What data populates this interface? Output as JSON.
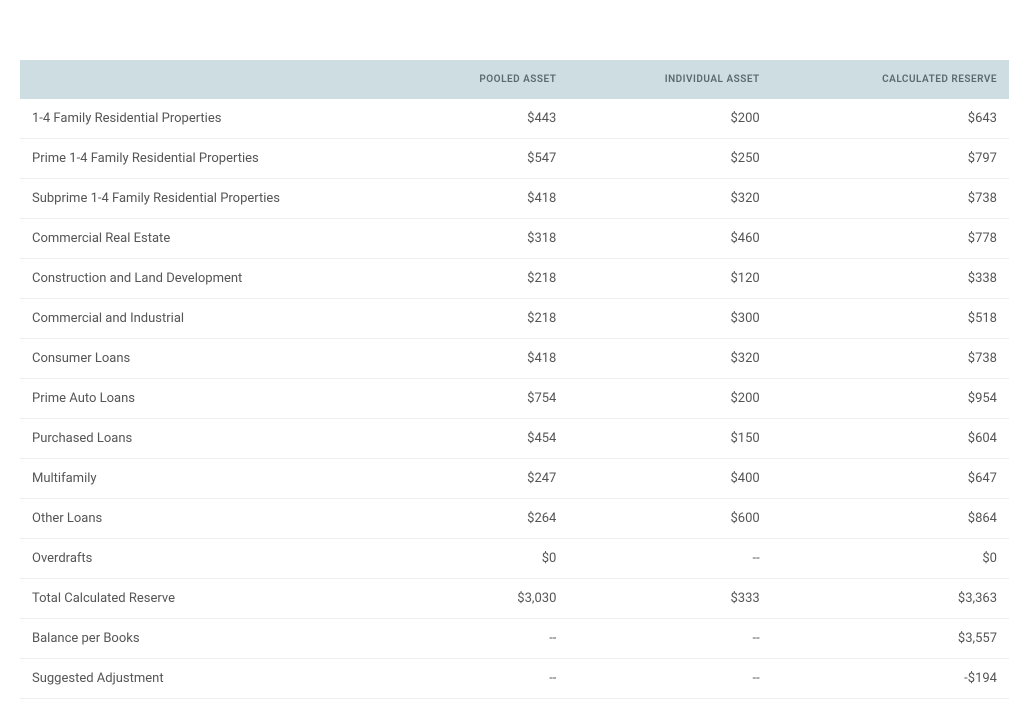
{
  "table": {
    "headers": [
      "",
      "POOLED ASSET",
      "INDIVIDUAL ASSET",
      "CALCULATED RESERVE"
    ],
    "rows": [
      {
        "label": "1-4 Family Residential Properties",
        "pooled": "$443",
        "individual": "$200",
        "calculated": "$643"
      },
      {
        "label": "Prime 1-4 Family Residential Properties",
        "pooled": "$547",
        "individual": "$250",
        "calculated": "$797"
      },
      {
        "label": "Subprime 1-4 Family Residential Properties",
        "pooled": "$418",
        "individual": "$320",
        "calculated": "$738"
      },
      {
        "label": "Commercial Real Estate",
        "pooled": "$318",
        "individual": "$460",
        "calculated": "$778"
      },
      {
        "label": "Construction and Land Development",
        "pooled": "$218",
        "individual": "$120",
        "calculated": "$338"
      },
      {
        "label": "Commercial and Industrial",
        "pooled": "$218",
        "individual": "$300",
        "calculated": "$518"
      },
      {
        "label": "Consumer Loans",
        "pooled": "$418",
        "individual": "$320",
        "calculated": "$738"
      },
      {
        "label": "Prime Auto Loans",
        "pooled": "$754",
        "individual": "$200",
        "calculated": "$954"
      },
      {
        "label": "Purchased Loans",
        "pooled": "$454",
        "individual": "$150",
        "calculated": "$604"
      },
      {
        "label": "Multifamily",
        "pooled": "$247",
        "individual": "$400",
        "calculated": "$647"
      },
      {
        "label": "Other Loans",
        "pooled": "$264",
        "individual": "$600",
        "calculated": "$864"
      },
      {
        "label": "Overdrafts",
        "pooled": "$0",
        "individual": "--",
        "calculated": "$0"
      },
      {
        "label": "Total Calculated Reserve",
        "pooled": "$3,030",
        "individual": "$333",
        "calculated": "$3,363"
      },
      {
        "label": "Balance per Books",
        "pooled": "--",
        "individual": "--",
        "calculated": "$3,557"
      },
      {
        "label": "Suggested Adjustment",
        "pooled": "--",
        "individual": "--",
        "calculated": "-$194"
      }
    ]
  }
}
